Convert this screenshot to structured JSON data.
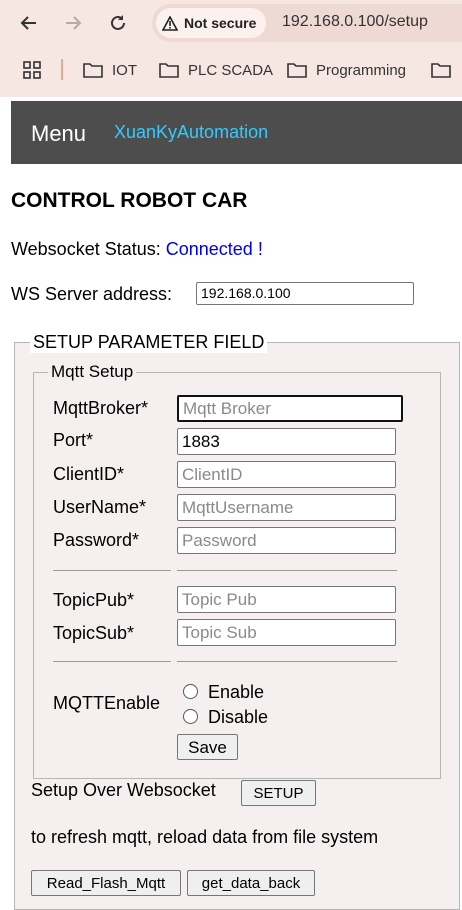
{
  "browser": {
    "security_label": "Not secure",
    "url": "192.168.0.100/setup",
    "bookmarks": [
      "IOT",
      "PLC SCADA",
      "Programming"
    ]
  },
  "header": {
    "menu_label": "Menu",
    "brand": "XuanKyAutomation"
  },
  "page": {
    "title": "CONTROL ROBOT CAR",
    "ws_status_label": "Websocket Status: ",
    "ws_status_value": "Connected !",
    "ws_address_label": "WS Server address:",
    "ws_address_value": "192.168.0.100"
  },
  "setup": {
    "legend": "SETUP PARAMETER FIELD",
    "mqtt_legend": "Mqtt Setup",
    "fields": {
      "broker": {
        "label": "MqttBroker*",
        "value": "",
        "placeholder": "Mqtt Broker"
      },
      "port": {
        "label": "Port*",
        "value": "1883",
        "placeholder": ""
      },
      "client_id": {
        "label": "ClientID*",
        "value": "",
        "placeholder": "ClientID"
      },
      "username": {
        "label": "UserName*",
        "value": "",
        "placeholder": "MqttUsername"
      },
      "password": {
        "label": "Password*",
        "value": "",
        "placeholder": "Password"
      },
      "topic_pub": {
        "label": "TopicPub*",
        "value": "",
        "placeholder": "Topic Pub"
      },
      "topic_sub": {
        "label": "TopicSub*",
        "value": "",
        "placeholder": "Topic Sub"
      }
    },
    "mqtt_enable_label": "MQTTEnable",
    "enable_option": "Enable",
    "disable_option": "Disable",
    "save_label": "Save",
    "ws_setup_text": "Setup Over Websocket",
    "setup_button": "SETUP",
    "refresh_text": "to refresh mqtt, reload data from file system",
    "read_flash_button": "Read_Flash_Mqtt",
    "get_data_button": "get_data_back"
  },
  "colors": {
    "chrome_bg": "#f6e7e2",
    "menu_bg": "#4d4d4d",
    "brand": "#33ccff",
    "status_link": "#0000ee",
    "fieldset_bg": "#f5efef"
  }
}
